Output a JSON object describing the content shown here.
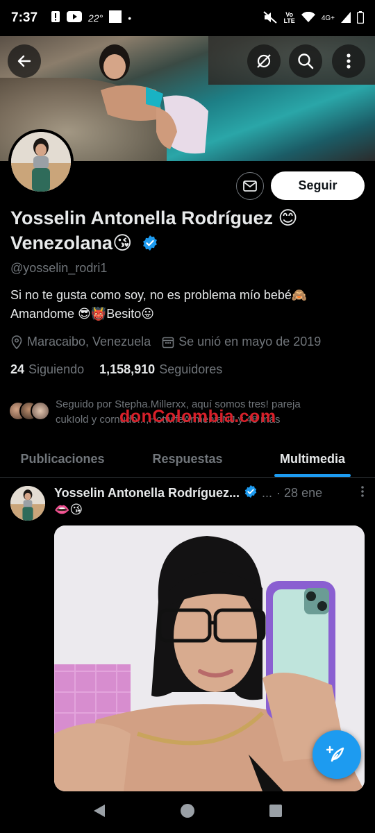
{
  "status_bar": {
    "time": "7:37",
    "temperature": "22°",
    "network": "4G+"
  },
  "profile": {
    "display_name": "Yosselin Antonella Rodríguez 😊 Venezolana😘",
    "handle": "@yosselin_rodri1",
    "bio_line1": "Si no te gusta como soy, no es problema mío bebé🙈",
    "bio_line2": "Amandome 😎👹Besito😛",
    "location": "Maracaibo, Venezuela",
    "joined": "Se unió en mayo de 2019",
    "following_count": "24",
    "following_label": "Siguiendo",
    "followers_count": "1,158,910",
    "followers_label": "Seguidores",
    "followed_by_line1": "Seguido por Stepha.Millerxx, aquí somos tres! pareja",
    "followed_by_line2": "cukIold y cornudo...,HotwifeArmeniaNJ y 48 más",
    "follow_button": "Seguir"
  },
  "watermark": "donColombia.com",
  "tabs": [
    {
      "label": "Publicaciones",
      "active": false
    },
    {
      "label": "Respuestas",
      "active": false
    },
    {
      "label": "Multimedia",
      "active": true
    }
  ],
  "post": {
    "author": "Yosselin Antonella Rodríguez...",
    "truncation": "...",
    "date": "· 28 ene",
    "text": "👄😘"
  },
  "colors": {
    "accent": "#1d9bf0",
    "background": "#000000",
    "muted": "#71767b",
    "watermark": "#d8202a"
  },
  "icons": {
    "back": "back-arrow-icon",
    "no_translate": "hide-retweets-icon",
    "search": "search-icon",
    "more": "more-vertical-icon",
    "message": "mail-icon",
    "location": "location-pin-icon",
    "calendar": "calendar-icon",
    "verified": "verified-badge-icon",
    "compose": "compose-post-icon"
  }
}
